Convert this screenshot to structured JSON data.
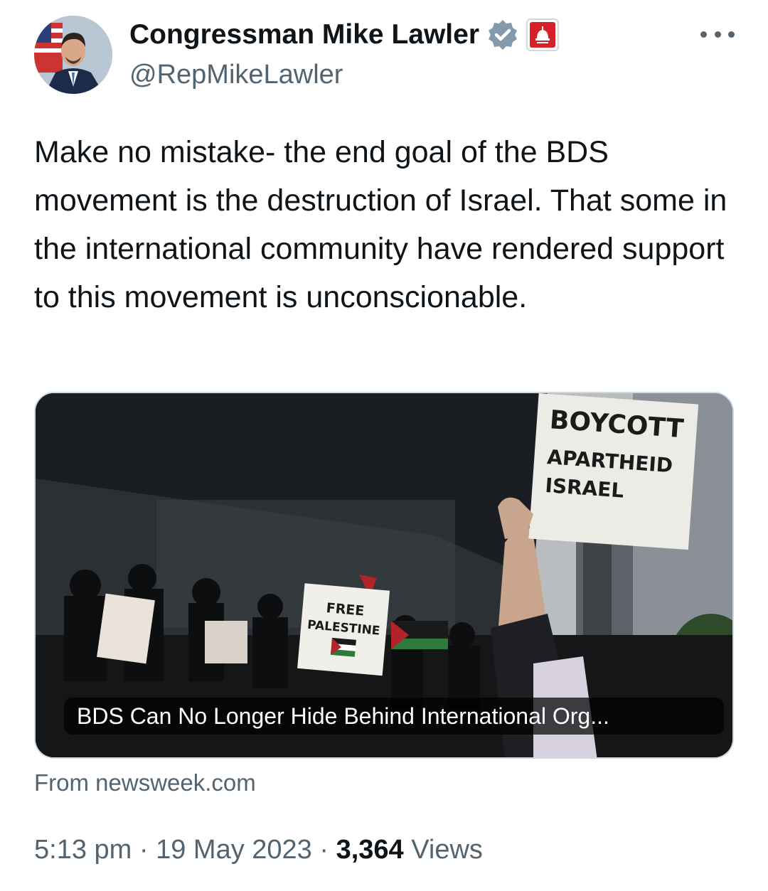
{
  "author": {
    "name": "Congressman Mike Lawler",
    "handle": "@RepMikeLawler",
    "verified_icon": "verified-badge-icon",
    "affiliation_icon": "capitol-dome-icon"
  },
  "tweet": {
    "text": "Make no mistake- the end goal of the BDS movement is the destruction of Israel. That some in the international community have rendered support to this movement is unconscionable."
  },
  "card": {
    "title": "BDS Can No Longer Hide Behind International Org...",
    "source": "From newsweek.com",
    "image_signs": {
      "sign1_line1": "BOYCOTT",
      "sign1_line2": "APARTHEID",
      "sign1_line3": "ISRAEL",
      "sign2_line1": "FREE",
      "sign2_line2": "PALESTINE"
    }
  },
  "meta": {
    "time": "5:13 pm",
    "separator": "·",
    "date": "19 May 2023",
    "views_count": "3,364",
    "views_label": "Views"
  },
  "colors": {
    "text": "#0f1419",
    "secondary": "#536471",
    "verified": "#829aab",
    "affiliation": "#d6202a"
  }
}
